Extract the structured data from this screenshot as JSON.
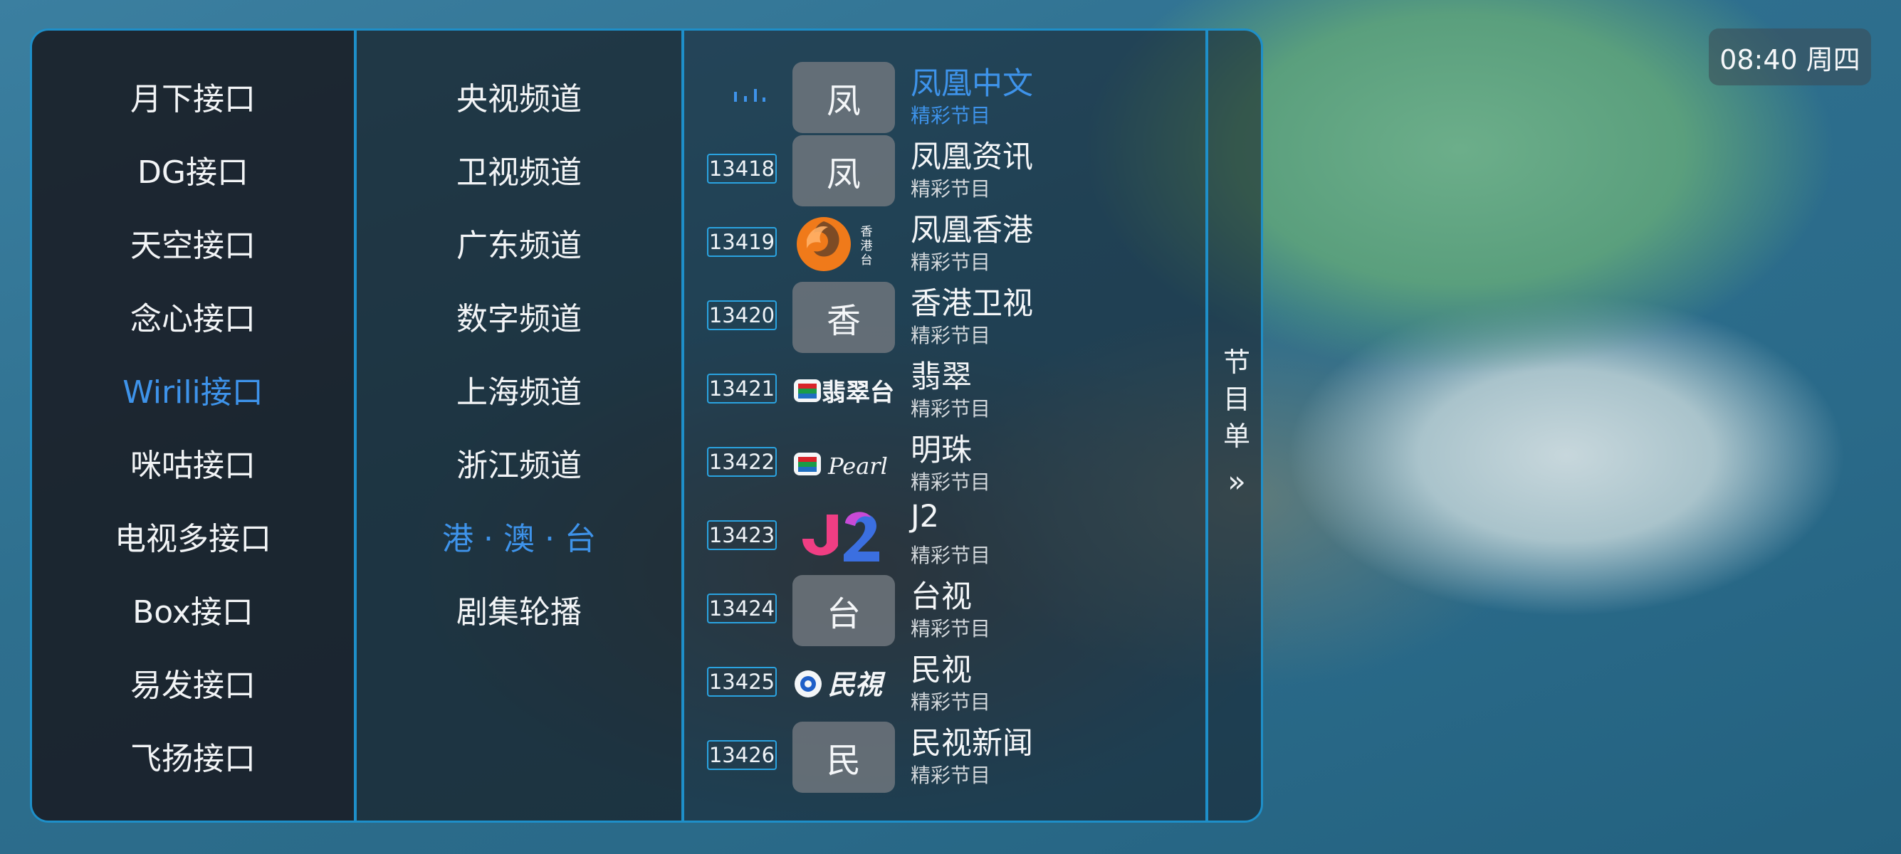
{
  "sources": [
    {
      "label": "月下接口",
      "selected": false
    },
    {
      "label": "DG接口",
      "selected": false
    },
    {
      "label": "天空接口",
      "selected": false
    },
    {
      "label": "念心接口",
      "selected": false
    },
    {
      "label": "Wirili接口",
      "selected": true
    },
    {
      "label": "咪咕接口",
      "selected": false
    },
    {
      "label": "电视多接口",
      "selected": false
    },
    {
      "label": "Box接口",
      "selected": false
    },
    {
      "label": "易发接口",
      "selected": false
    },
    {
      "label": "飞扬接口",
      "selected": false
    }
  ],
  "categories": [
    {
      "label": "央视频道",
      "selected": false
    },
    {
      "label": "卫视频道",
      "selected": false
    },
    {
      "label": "广东频道",
      "selected": false
    },
    {
      "label": "数字频道",
      "selected": false
    },
    {
      "label": "上海频道",
      "selected": false
    },
    {
      "label": "浙江频道",
      "selected": false
    },
    {
      "label": "港 · 澳 · 台",
      "selected": true
    },
    {
      "label": "剧集轮播",
      "selected": false
    }
  ],
  "channels": [
    {
      "number": "",
      "name": "凤凰中文",
      "program": "精彩节目",
      "logo_text": "凤",
      "logo": "text",
      "playing": true
    },
    {
      "number": "13418",
      "name": "凤凰资讯",
      "program": "精彩节目",
      "logo_text": "凤",
      "logo": "text",
      "playing": false
    },
    {
      "number": "13419",
      "name": "凤凰香港",
      "program": "精彩节目",
      "logo_text": "香港台",
      "logo": "phoenix-hk-logo",
      "playing": false
    },
    {
      "number": "13420",
      "name": "香港卫视",
      "program": "精彩节目",
      "logo_text": "香",
      "logo": "text",
      "playing": false
    },
    {
      "number": "13421",
      "name": "翡翠",
      "program": "精彩节目",
      "logo_text": "翡翠台",
      "logo": "tvb-jade-logo",
      "playing": false
    },
    {
      "number": "13422",
      "name": "明珠",
      "program": "精彩节目",
      "logo_text": "Pearl",
      "logo": "tvb-pearl-logo",
      "playing": false
    },
    {
      "number": "13423",
      "name": "J2",
      "program": "精彩节目",
      "logo_text": "J2",
      "logo": "j2-logo",
      "playing": false
    },
    {
      "number": "13424",
      "name": "台视",
      "program": "精彩节目",
      "logo_text": "台",
      "logo": "text",
      "playing": false
    },
    {
      "number": "13425",
      "name": "民视",
      "program": "精彩节目",
      "logo_text": "民視",
      "logo": "ftv-logo",
      "playing": false
    },
    {
      "number": "13426",
      "name": "民视新闻",
      "program": "精彩节目",
      "logo_text": "民",
      "logo": "text",
      "playing": false
    }
  ],
  "epg": {
    "chars": [
      "节",
      "目",
      "单"
    ],
    "arrow": "»"
  },
  "clock": "08:40 周四",
  "colors": {
    "accent": "#3e93ea",
    "border": "#1e8fc9"
  }
}
